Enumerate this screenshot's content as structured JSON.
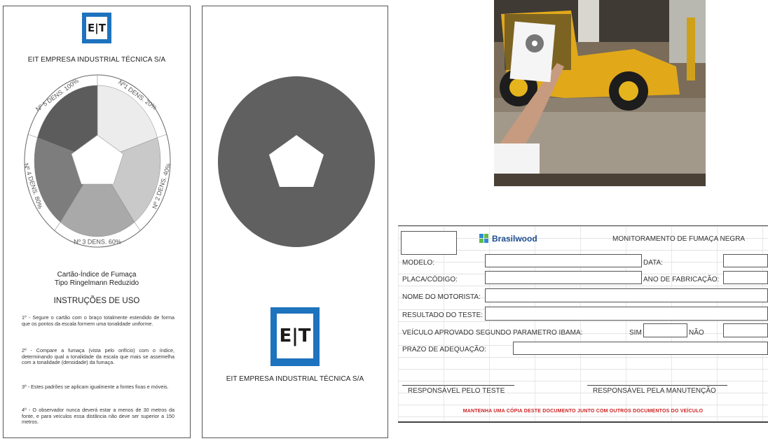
{
  "card1": {
    "logo_text": "E|T",
    "company": "EIT EMPRESA INDUSTRIAL TÉCNICA S/A",
    "wheel_labels": [
      "Nº1 DENS. 20%",
      "Nº 2 DENS. 40%",
      "Nº 3 DENS. 60%",
      "Nº 4 DENS. 80%",
      "Nº 5 DENS. 100%"
    ],
    "title_line1": "Cartão-Índice de Fumaça",
    "title_line2": "Tipo Ringelmann Reduzido",
    "instructions_title": "INSTRUÇÕES DE USO",
    "instructions": [
      "1º - Segure o cartão com o braço totalmente estendido de forma que os pontos da escala formem uma tonalidade uniforme.",
      "2º - Compare a fumaça (vista pelo orifício) com o índice, determinando qual a tonalidade da escala que mais se assemelha com a tonalidade (densidade) da fumaça.",
      "3º - Estes padrões se aplicam igualmente a fontes fixas e móveis.",
      "4º - O observador nunca deverá estar a menos de 30 metros da fonte, e para veículos essa distância não deve ser superior a 150 metros."
    ],
    "wheel_colors": [
      "#ececec",
      "#c9c9c9",
      "#a9a9a9",
      "#7d7d7d",
      "#5c5c5c"
    ]
  },
  "card2": {
    "logo_text": "E|T",
    "company": "EIT EMPRESA INDUSTRIAL TÉCNICA S/A",
    "disc_color": "#606060"
  },
  "form": {
    "brand": "Brasilwood",
    "title": "MONITORAMENTO DE FUMAÇA NEGRA",
    "modelo": "MODELO:",
    "data": "DATA:",
    "placa": "PLACA/CÓDIGO:",
    "ano": "ANO DE FABRICAÇÃO:",
    "motorista": "NOME DO MOTORISTA:",
    "resultado": "RESULTADO DO TESTE:",
    "aprovado": "VEÍCULO APROVADO SEGUNDO PARAMETRO IBAMA:",
    "sim": "SIM",
    "nao": "NÃO",
    "prazo": "PRAZO DE ADEQUAÇÃO:",
    "resp_teste": "RESPONSÁVEL PELO TESTE",
    "resp_manut": "RESPONSÁVEL PELA MANUTENÇÃO",
    "aviso": "MANTENHA UMA CÓPIA DESTE DOCUMENTO JUNTO COM OUTROS DOCUMENTOS DO VEÍCULO"
  }
}
